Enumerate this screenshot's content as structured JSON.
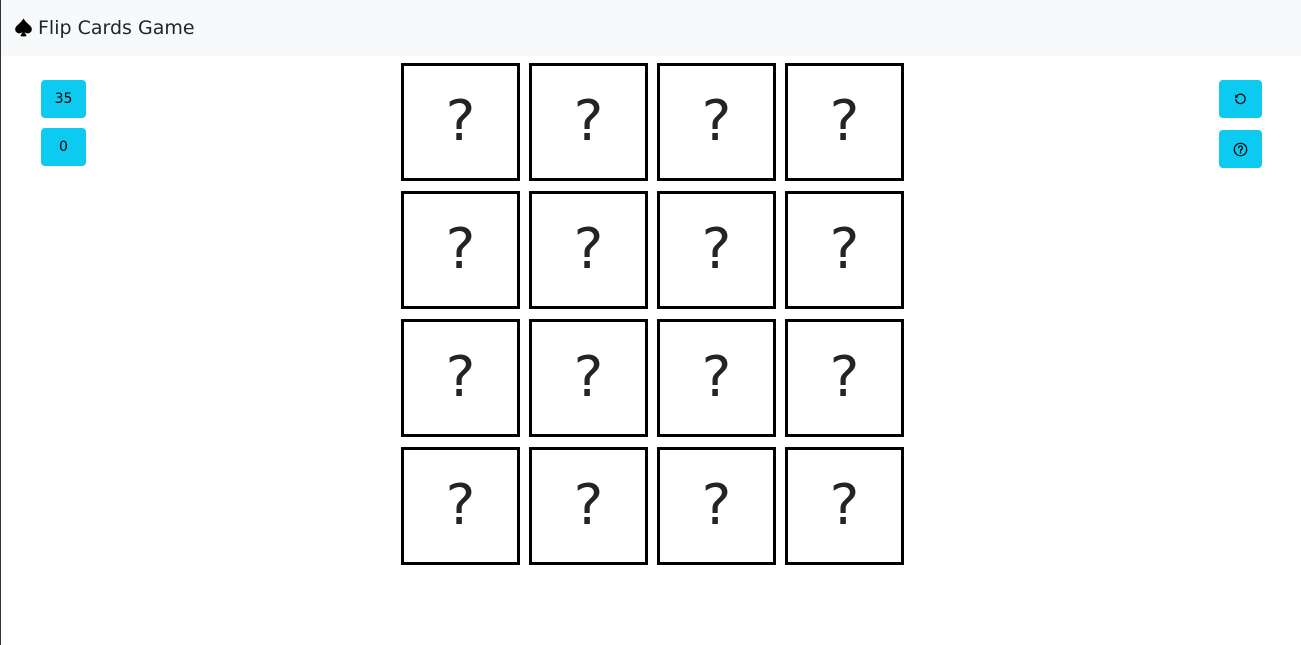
{
  "navbar": {
    "brand_icon": "spade-icon",
    "brand_title": "Flip Cards Game"
  },
  "left_panel": {
    "moves_counter": "35",
    "score_counter": "0"
  },
  "right_panel": {
    "restart_icon": "rotate-ccw-icon",
    "help_icon": "question-circle-icon"
  },
  "colors": {
    "accent": "#0dcaf0",
    "navbar_bg": "#f8f9fa",
    "card_border": "#000000",
    "text": "#212529"
  },
  "board": {
    "rows": 4,
    "columns": 4,
    "cards": [
      {
        "face": "?"
      },
      {
        "face": "?"
      },
      {
        "face": "?"
      },
      {
        "face": "?"
      },
      {
        "face": "?"
      },
      {
        "face": "?"
      },
      {
        "face": "?"
      },
      {
        "face": "?"
      },
      {
        "face": "?"
      },
      {
        "face": "?"
      },
      {
        "face": "?"
      },
      {
        "face": "?"
      },
      {
        "face": "?"
      },
      {
        "face": "?"
      },
      {
        "face": "?"
      },
      {
        "face": "?"
      }
    ]
  }
}
